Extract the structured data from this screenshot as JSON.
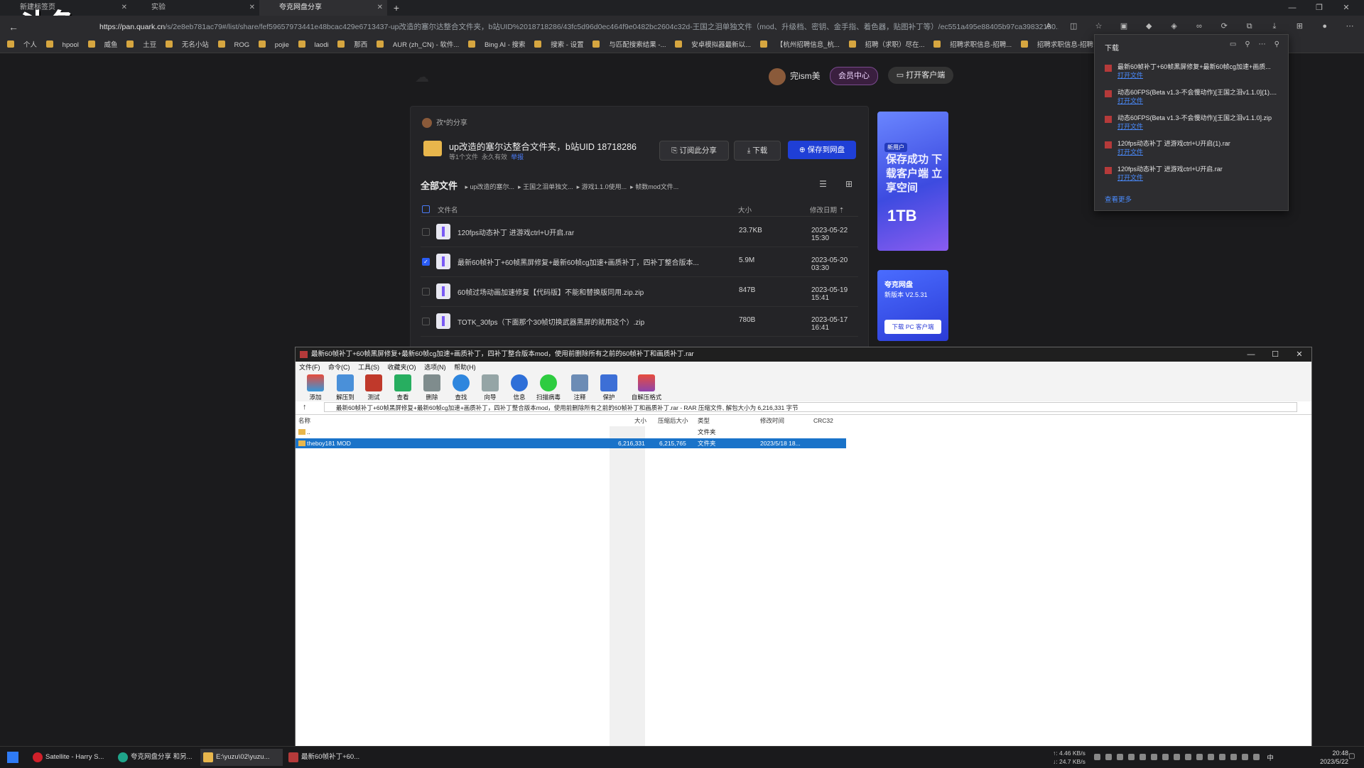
{
  "browser": {
    "tabs": [
      {
        "label": "新建标签页"
      },
      {
        "label": "实验"
      },
      {
        "label": "夸克网盘分享"
      }
    ],
    "url_host": "https://pan.quark.cn",
    "url_rest": "/s/2e8eb781ac79#/list/share/fef59657973441e48bcac429e6713437-up改造的塞尔达整合文件夹，b站UID%2018718286/43fc5d96d0ec464f9e0482bc2604c32d-王国之泪单独文件（mod、升级档、密钥、金手指、着色器，贴图补丁等）/ec551a495e88405b97ca39832180...",
    "bookmarks": [
      "个人",
      "hpool",
      "威鱼",
      "土豆",
      "无名小站",
      "ROG",
      "pojie",
      "laodi",
      "那西",
      "AUR (zh_CN) - 软件...",
      "Bing AI - 搜索",
      "搜索 - 设置",
      "与匹配搜索结果 -...",
      "安卓模拟器最新以...",
      "【杭州招聘信息_杭...",
      "招聘（求职）尽在...",
      "招聘求职信息-招聘...",
      "招聘求职信息-招聘..."
    ],
    "overlay_logo": "斗鱼"
  },
  "quark": {
    "user_name": "完ism美",
    "vip_label": "会员中心",
    "client_label": "打开客户端",
    "sharer": "孜*的分享",
    "share_title": "up改造的塞尔达整合文件夹，b站UID 18718286",
    "share_meta_count": "等1个文件",
    "share_meta_valid": "永久有效",
    "share_meta_report": "举报",
    "subscribe_label": "订阅此分享",
    "download_label": "下载",
    "save_label": "保存到网盘",
    "crumb_root": "全部文件",
    "crumbs": [
      "up改造的塞尔...",
      "王国之泪单独文...",
      "游戏1.1.0使用...",
      "帧数mod文件..."
    ],
    "col_name": "文件名",
    "col_size": "大小",
    "col_date": "修改日期",
    "files": [
      {
        "name": "120fps动态补丁 进游戏ctrl+U开启.rar",
        "size": "23.7KB",
        "date": "2023-05-22 15:30",
        "checked": false
      },
      {
        "name": "最新60帧补丁+60帧黑屏修复+最新60帧cg加速+画质补丁，四补丁整合版本...",
        "size": "5.9M",
        "date": "2023-05-20 03:30",
        "checked": true
      },
      {
        "name": "60帧过场动画加速修复【代码版】不能和替换版同用.zip.zip",
        "size": "847B",
        "date": "2023-05-19 15:41",
        "checked": false
      },
      {
        "name": "TOTK_30fps（下面那个30帧切换武器黑屏的就用这个）.zip",
        "size": "780B",
        "date": "2023-05-17 16:41",
        "checked": false
      }
    ],
    "ad1_tag": "新用户",
    "ad1_text": "保存成功 下载客户端 立享空间",
    "ad1_big": "1TB",
    "ad2_title": "夸克网盘",
    "ad2_version": "新版本 V2.5.31",
    "ad2_button": "下载 PC 客户端"
  },
  "downloads": {
    "header": "下载",
    "open_label": "打开文件",
    "items": [
      "最新60帧补丁+60帧黑屏修复+最新60帧cg加速+画质...",
      "动态60FPS(Beta v1.3-不会慢动作)[王国之泪v1.1.0](1)....",
      "动态60FPS(Beta v1.3-不会慢动作)[王国之泪v1.1.0].zip",
      "120fps动态补丁 进游戏ctrl+U开启(1).rar",
      "120fps动态补丁 进游戏ctrl+U开启.rar"
    ],
    "more_label": "查看更多"
  },
  "rar": {
    "title": "最新60帧补丁+60帧黑屏修复+最新60帧cg加速+画质补丁，四补丁整合版本mod，使用前删除所有之前的60帧补丁和画质补丁.rar",
    "menus": [
      "文件(F)",
      "命令(C)",
      "工具(S)",
      "收藏夹(O)",
      "选项(N)",
      "帮助(H)"
    ],
    "tools": [
      "添加",
      "解压到",
      "测试",
      "查看",
      "删除",
      "查找",
      "向导",
      "信息",
      "扫描病毒",
      "注释",
      "保护",
      "自解压格式"
    ],
    "path": "最新60帧补丁+60帧黑屏修复+最新60帧cg加速+画质补丁，四补丁整合版本mod，使用前删除所有之前的60帧补丁和画质补丁.rar - RAR 压缩文件, 解包大小为 6,216,331 字节",
    "cols": {
      "name": "名称",
      "size": "大小",
      "packed": "压缩后大小",
      "type": "类型",
      "mtime": "修改时间",
      "crc": "CRC32"
    },
    "parent_name": "..",
    "parent_type": "文件夹",
    "folder_name": "theboy181 MOD",
    "folder_size": "6,216,331",
    "folder_packed": "6,215,765",
    "folder_type": "文件夹",
    "folder_mtime": "2023/5/18 18..."
  },
  "taskbar": {
    "apps": [
      "Satellite - Harry S...",
      "夸克网盘分享 和另...",
      "E:\\yuzu\\02\\yuzu...",
      "最新60帧补丁+60..."
    ],
    "net_up": "↑: 4.46 KB/s",
    "net_down": "↓: 24.7 KB/s",
    "ime": "中",
    "time": "20:48",
    "date": "2023/5/22"
  }
}
